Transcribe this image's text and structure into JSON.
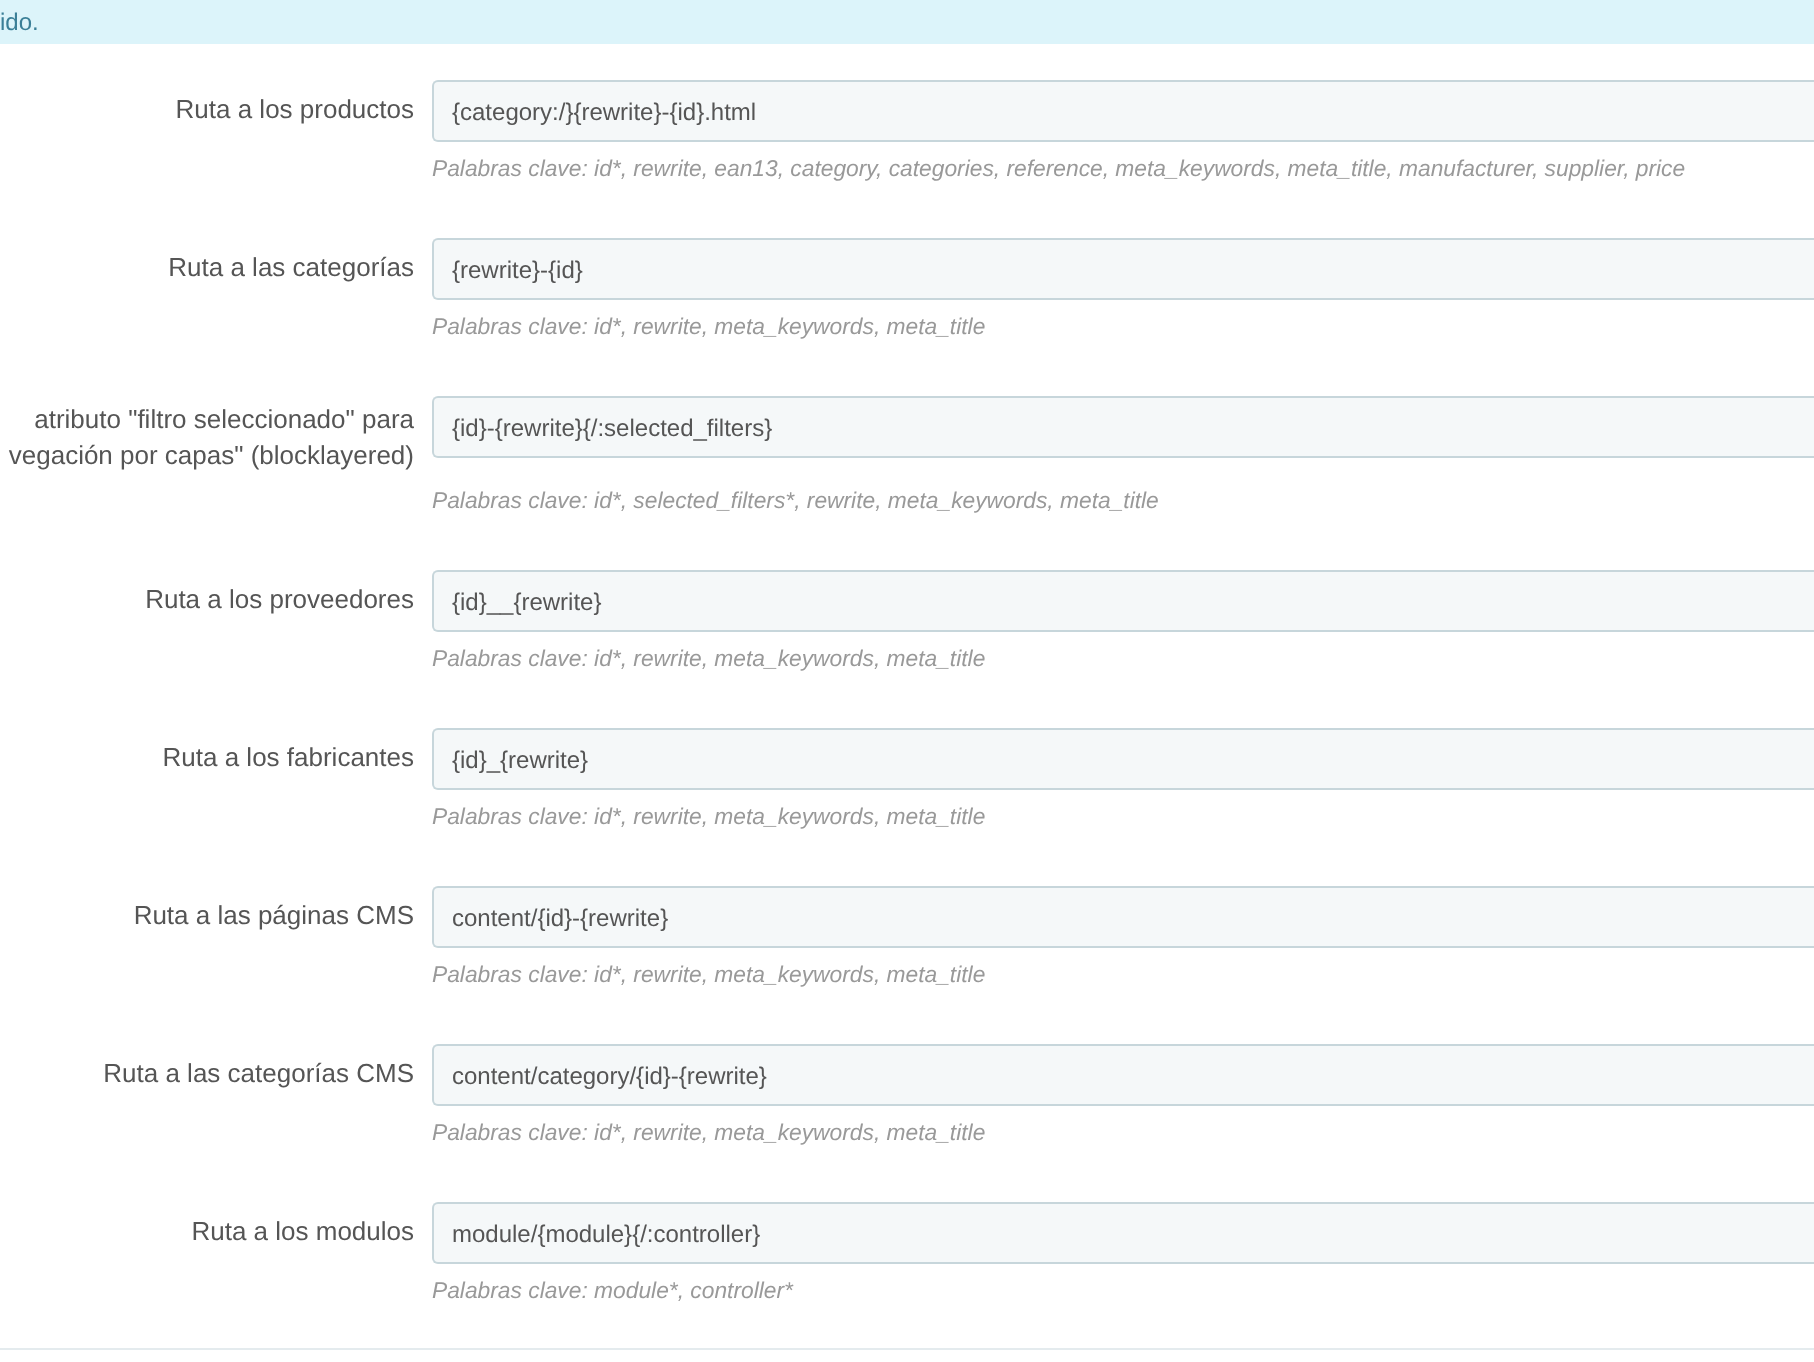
{
  "alert": {
    "text": "ido."
  },
  "fields": [
    {
      "label": "Ruta a los productos",
      "value": "{category:/}{rewrite}-{id}.html",
      "help": "Palabras clave: id*, rewrite, ean13, category, categories, reference, meta_keywords, meta_title, manufacturer, supplier, price"
    },
    {
      "label": "Ruta a las categorías",
      "value": "{rewrite}-{id}",
      "help": "Palabras clave: id*, rewrite, meta_keywords, meta_title"
    },
    {
      "label": "atributo \"filtro seleccionado\" para\nvegación por capas\" (blocklayered)",
      "value": "{id}-{rewrite}{/:selected_filters}",
      "help": "Palabras clave: id*, selected_filters*, rewrite, meta_keywords, meta_title"
    },
    {
      "label": "Ruta a los proveedores",
      "value": "{id}__{rewrite}",
      "help": "Palabras clave: id*, rewrite, meta_keywords, meta_title"
    },
    {
      "label": "Ruta a los fabricantes",
      "value": "{id}_{rewrite}",
      "help": "Palabras clave: id*, rewrite, meta_keywords, meta_title"
    },
    {
      "label": "Ruta a las páginas CMS",
      "value": "content/{id}-{rewrite}",
      "help": "Palabras clave: id*, rewrite, meta_keywords, meta_title"
    },
    {
      "label": "Ruta a las categorías CMS",
      "value": "content/category/{id}-{rewrite}",
      "help": "Palabras clave: id*, rewrite, meta_keywords, meta_title"
    },
    {
      "label": "Ruta a los modulos",
      "value": "module/{module}{/:controller}",
      "help": "Palabras clave: module*, controller*"
    }
  ]
}
